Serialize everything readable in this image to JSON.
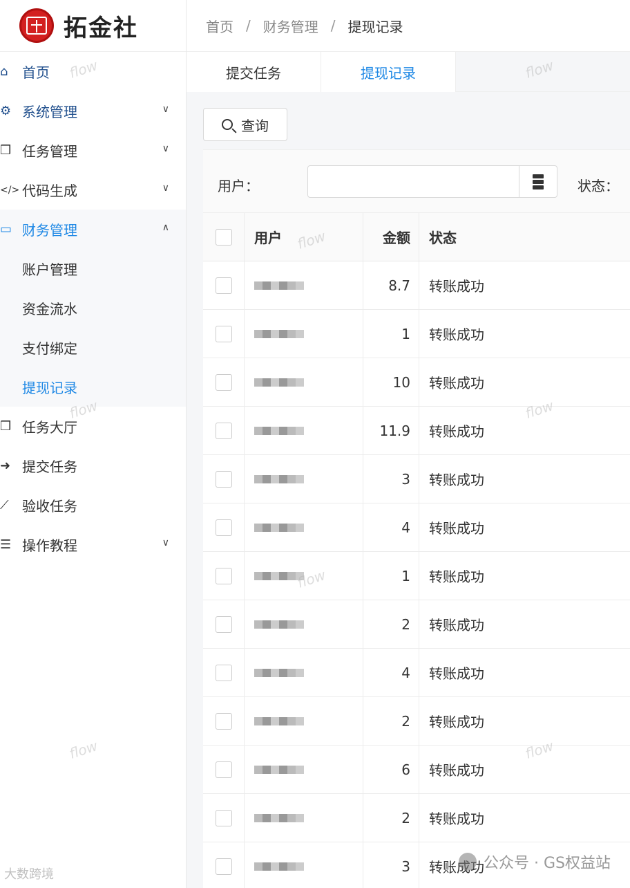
{
  "app": {
    "name": "拓金社"
  },
  "sidebar": {
    "items": [
      {
        "icon": "home-icon",
        "label": "首页"
      },
      {
        "icon": "gears-icon",
        "label": "系统管理"
      },
      {
        "icon": "cubes-icon",
        "label": "任务管理"
      },
      {
        "icon": "code-icon",
        "label": "代码生成"
      },
      {
        "icon": "money-icon",
        "label": "财务管理"
      },
      {
        "icon": "cubes-icon",
        "label": "任务大厅"
      },
      {
        "icon": "arrow-right-icon",
        "label": "提交任务"
      },
      {
        "icon": "telescope-icon",
        "label": "验收任务"
      },
      {
        "icon": "list-icon",
        "label": "操作教程"
      }
    ],
    "finance_sub": [
      "账户管理",
      "资金流水",
      "支付绑定",
      "提现记录"
    ]
  },
  "breadcrumb": {
    "home": "首页",
    "sep": "/",
    "section": "财务管理",
    "current": "提现记录"
  },
  "tabs": [
    "提交任务",
    "提现记录"
  ],
  "toolbar": {
    "query_label": "查询"
  },
  "filter": {
    "user_label": "用户：",
    "status_label": "状态：",
    "user_value": ""
  },
  "table": {
    "headers": {
      "user": "用户",
      "amount": "金额",
      "status": "状态"
    },
    "rows": [
      {
        "amount": "8.7",
        "status": "转账成功"
      },
      {
        "amount": "1",
        "status": "转账成功"
      },
      {
        "amount": "10",
        "status": "转账成功"
      },
      {
        "amount": "11.9",
        "status": "转账成功"
      },
      {
        "amount": "3",
        "status": "转账成功"
      },
      {
        "amount": "4",
        "status": "转账成功"
      },
      {
        "amount": "1",
        "status": "转账成功"
      },
      {
        "amount": "2",
        "status": "转账成功"
      },
      {
        "amount": "4",
        "status": "转账成功"
      },
      {
        "amount": "2",
        "status": "转账成功"
      },
      {
        "amount": "6",
        "status": "转账成功"
      },
      {
        "amount": "2",
        "status": "转账成功"
      },
      {
        "amount": "3",
        "status": "转账成功"
      }
    ]
  },
  "watermark": {
    "text": "flow"
  },
  "overlay": {
    "wechat": "公众号 · GS权益站",
    "corner": "大数跨境"
  },
  "colors": {
    "accent": "#1e88e5",
    "logo": "#d32020"
  }
}
